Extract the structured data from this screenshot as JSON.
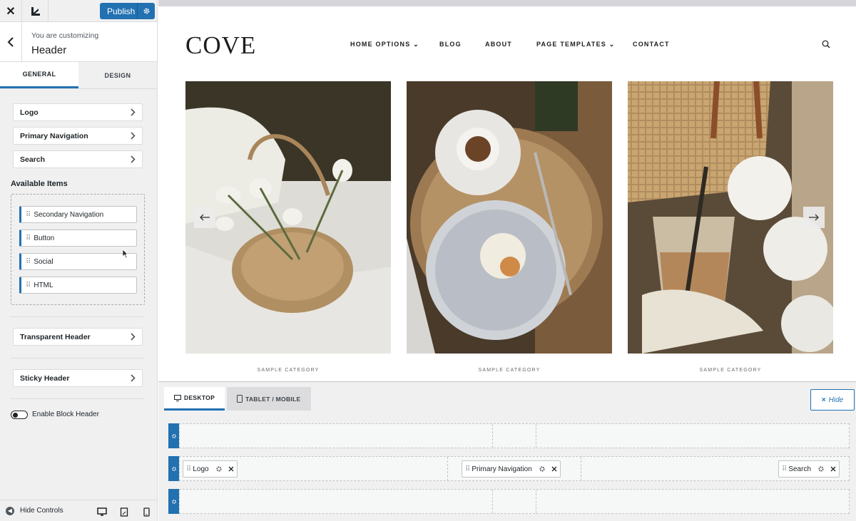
{
  "sidebar": {
    "publish_label": "Publish",
    "crumb_sub": "You are customizing",
    "crumb_title": "Header",
    "tabs": [
      "GENERAL",
      "DESIGN"
    ],
    "sections": [
      "Logo",
      "Primary Navigation",
      "Search"
    ],
    "available_title": "Available Items",
    "available_items": [
      "Secondary Navigation",
      "Button",
      "Social",
      "HTML"
    ],
    "transparent_header": "Transparent Header",
    "sticky_header": "Sticky Header",
    "block_header_label": "Enable Block Header",
    "hide_controls": "Hide Controls"
  },
  "preview": {
    "logo": "COVE",
    "nav": [
      "HOME OPTIONS ⌄",
      "BLOG",
      "ABOUT",
      "PAGE TEMPLATES ⌄",
      "CONTACT"
    ],
    "categories": [
      "SAMPLE CATEGORY",
      "SAMPLE CATEGORY",
      "SAMPLE CATEGORY"
    ]
  },
  "builder": {
    "tabs": [
      "DESKTOP",
      "TABLET / MOBILE"
    ],
    "hide_label": "Hide",
    "chips": [
      "Logo",
      "Primary Navigation",
      "Search"
    ]
  },
  "colors": {
    "accent": "#2271b1"
  }
}
